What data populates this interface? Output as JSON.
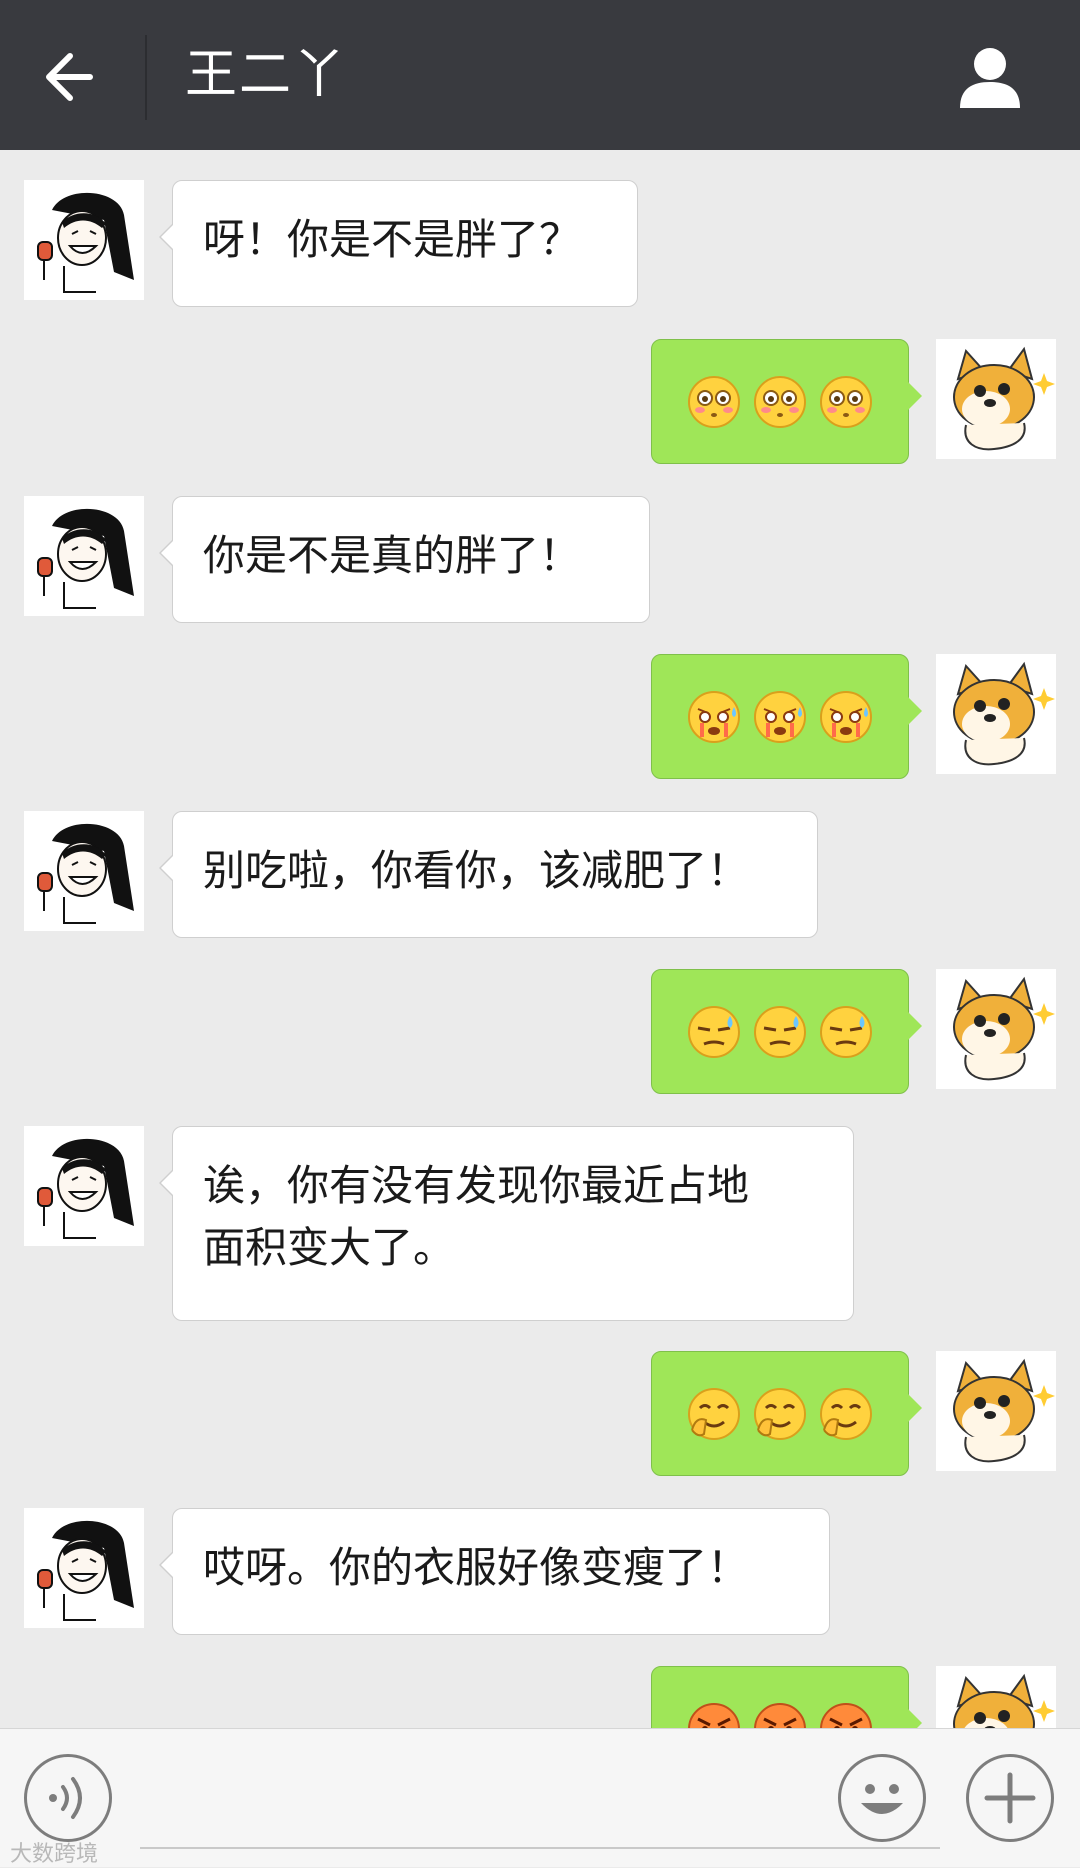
{
  "header": {
    "title": "王二丫",
    "back_icon": "arrow-left-icon",
    "contact_icon": "person-icon",
    "bg_color": "#393a3f"
  },
  "messages": [
    {
      "side": "left",
      "text": "呀！你是不是胖了？"
    },
    {
      "side": "right",
      "emoji": "flushed-face",
      "count": 3
    },
    {
      "side": "left",
      "text": "你是不是真的胖了！"
    },
    {
      "side": "right",
      "emoji": "crying-face",
      "count": 3
    },
    {
      "side": "left",
      "text": "别吃啦，你看你，该减肥了！"
    },
    {
      "side": "right",
      "emoji": "awkward-sweat-face",
      "count": 3
    },
    {
      "side": "left",
      "text_lines": [
        "诶，你有没有发现你最近占地",
        "面积变大了。"
      ]
    },
    {
      "side": "right",
      "emoji": "shy-face",
      "count": 3
    },
    {
      "side": "left",
      "text": "哎呀。你的衣服好像变瘦了！"
    },
    {
      "side": "right",
      "emoji": "angry-face",
      "count": 3
    }
  ],
  "bottom_bar": {
    "voice_icon": "voice-icon",
    "emoji_icon": "smiley-icon",
    "plus_icon": "plus-icon"
  },
  "watermark": "大数跨境",
  "colors": {
    "background": "#ebebeb",
    "sent_bubble": "#9fe658",
    "received_bubble": "#ffffff"
  }
}
